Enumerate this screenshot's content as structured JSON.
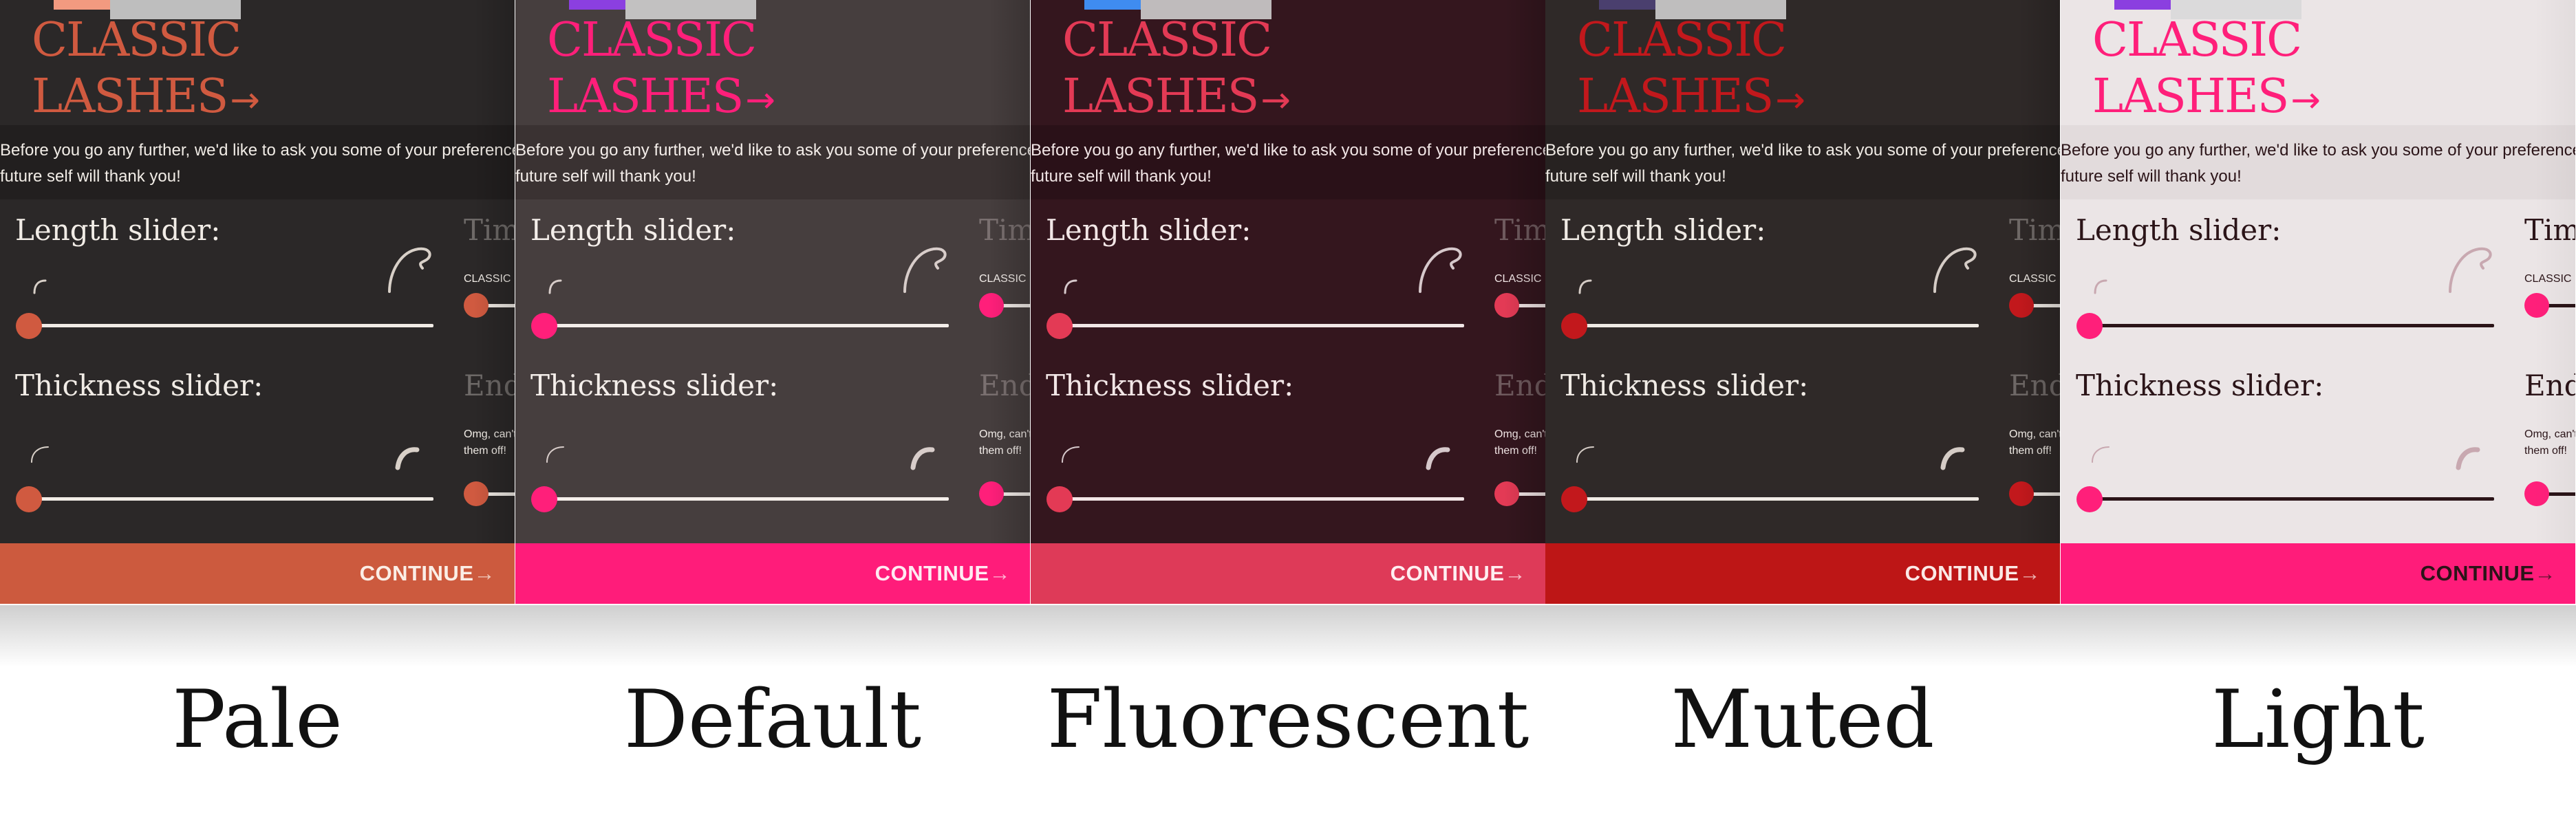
{
  "brand": {
    "line1": "CLASSIC",
    "line2": "LASHES",
    "arrow": "→"
  },
  "intro": {
    "line1": "Before you go any further, we'd like to ask you some of your preferences",
    "line2": "future self will thank you!"
  },
  "sliders": {
    "length_label": "Length slider:",
    "thickness_label": "Thickness slider:",
    "length_value": 0,
    "thickness_value": 0
  },
  "second_column": {
    "title1": "Tim",
    "caption1": "CLASSIC",
    "title2": "End",
    "caption2_line1": "Omg, can't",
    "caption2_line2": "them off!"
  },
  "continue": {
    "label": "CONTINUE",
    "arrow": "→"
  },
  "themes": [
    {
      "label": "Pale",
      "colors": {
        "bg": "#2b2828",
        "band": "#221f1f",
        "accent": "#d05a40",
        "button": "#cc5a3e",
        "button_text": "#fbeee6",
        "text": "#f1ece6",
        "muted": "#6e6a68",
        "track": "#f1ece6",
        "lash": "#d8d0c8",
        "swatch": "#f29a80"
      }
    },
    {
      "label": "Default",
      "colors": {
        "bg": "#463e3e",
        "band": "#3a3232",
        "accent": "#ff1f7a",
        "button": "#ff1c7a",
        "button_text": "#ffeaf2",
        "text": "#f4eeea",
        "muted": "#7a7070",
        "track": "#f4eeea",
        "lash": "#d8cdca",
        "swatch": "#8b3fe0"
      }
    },
    {
      "label": "Fluorescent",
      "colors": {
        "bg": "#34161e",
        "band": "#2a1118",
        "accent": "#e33a55",
        "button": "#de3a58",
        "button_text": "#ffeef1",
        "text": "#f2e6e6",
        "muted": "#6f5a5e",
        "track": "#f2e6e6",
        "lash": "#d6c8cb",
        "swatch": "#3f8cf0"
      }
    },
    {
      "label": "Muted",
      "colors": {
        "bg": "#2f2928",
        "band": "#272221",
        "accent": "#c2181c",
        "button": "#bd1616",
        "button_text": "#fbe9e6",
        "text": "#f0ebe5",
        "muted": "#6e6866",
        "track": "#f0ebe5",
        "lash": "#d5ccc6",
        "swatch": "#4a3f6e"
      }
    },
    {
      "label": "Light",
      "colors": {
        "bg": "#ebe5e6",
        "band": "#e2dbdc",
        "accent": "#ff1f7a",
        "button": "#ff1c7a",
        "button_text": "#2b1418",
        "text": "#2b1418",
        "muted": "#2b1418",
        "track": "#2b1418",
        "lash": "#c8a8b0",
        "swatch": "#8b3fe0"
      }
    }
  ]
}
